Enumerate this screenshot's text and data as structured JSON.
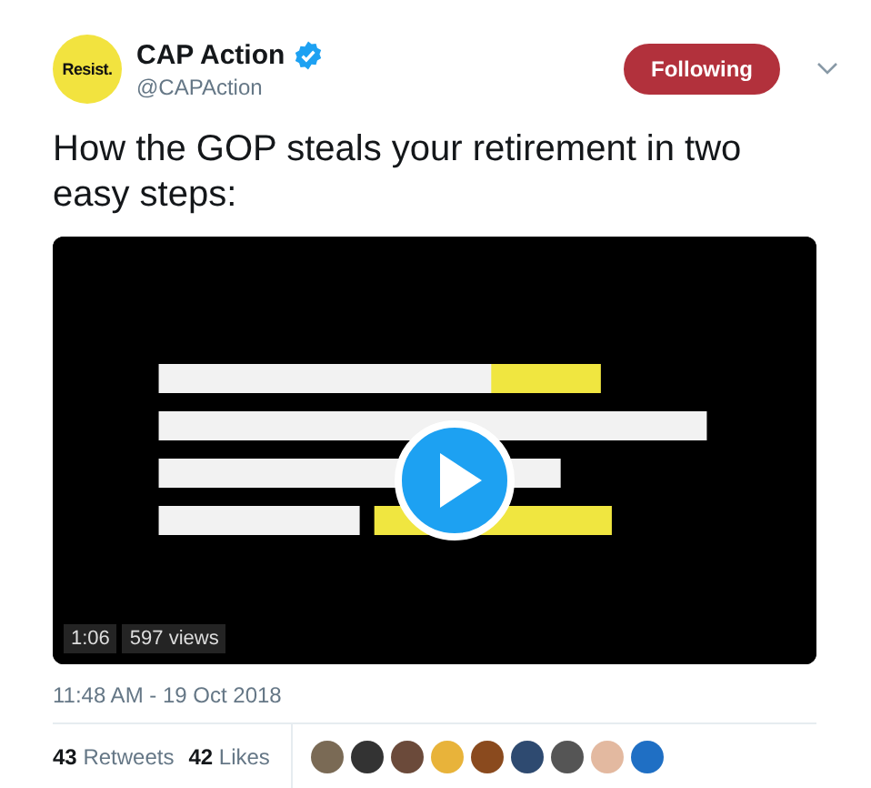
{
  "author": {
    "avatar_text": "Resist.",
    "name": "CAP Action",
    "verified": true,
    "handle": "@CAPAction"
  },
  "follow_button": {
    "label": "Following",
    "following": true
  },
  "tweet_text": "How the GOP steals your retirement in two easy steps:",
  "video": {
    "kind": "picture",
    "duration": "1:06",
    "views": "597 views"
  },
  "timestamp": "11:48 AM - 19 Oct 2018",
  "stats": [
    "**43** Retweets",
    "**42** Likes"
  ]
}
